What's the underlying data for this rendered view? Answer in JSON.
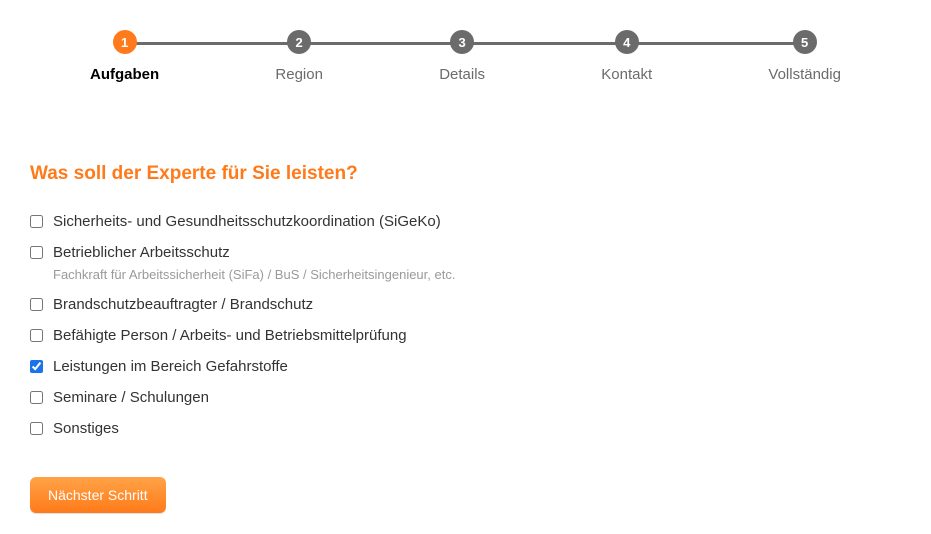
{
  "stepper": {
    "steps": [
      {
        "num": "1",
        "label": "Aufgaben",
        "active": true
      },
      {
        "num": "2",
        "label": "Region",
        "active": false
      },
      {
        "num": "3",
        "label": "Details",
        "active": false
      },
      {
        "num": "4",
        "label": "Kontakt",
        "active": false
      },
      {
        "num": "5",
        "label": "Vollständig",
        "active": false
      }
    ]
  },
  "form": {
    "title": "Was soll der Experte für Sie leisten?",
    "options": [
      {
        "label": "Sicherheits- und Gesundheitsschutzkoordination (SiGeKo)",
        "checked": false
      },
      {
        "label": "Betrieblicher Arbeitsschutz",
        "sublabel": "Fachkraft für Arbeitssicherheit (SiFa) / BuS / Sicherheitsingenieur, etc.",
        "checked": false
      },
      {
        "label": "Brandschutzbeauftragter / Brandschutz",
        "checked": false
      },
      {
        "label": "Befähigte Person / Arbeits- und Betriebsmittelprüfung",
        "checked": false
      },
      {
        "label": "Leistungen im Bereich Gefahrstoffe",
        "checked": true
      },
      {
        "label": "Seminare / Schulungen",
        "checked": false
      },
      {
        "label": "Sonstiges",
        "checked": false
      }
    ],
    "next_button": "Nächster Schritt"
  }
}
